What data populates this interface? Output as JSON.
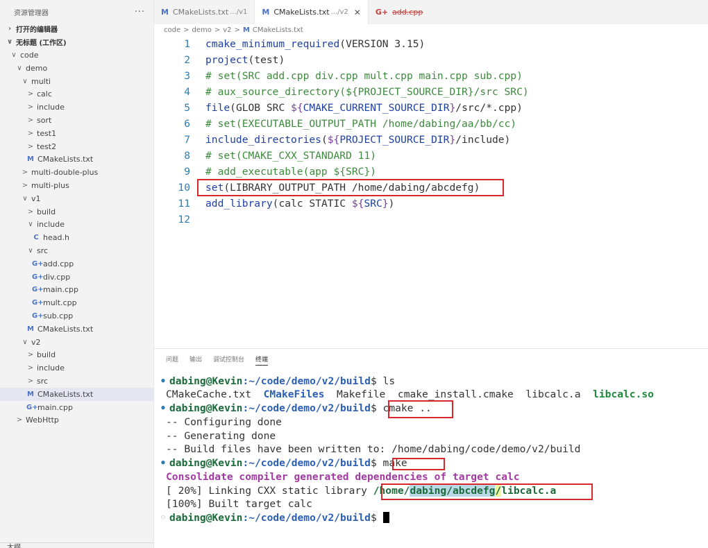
{
  "sidebar": {
    "title": "资源管理器",
    "more": "···",
    "open_editors": "打开的编辑器",
    "workspace": "无标题 (工作区)",
    "items": [
      {
        "label": "code",
        "chev": "∨",
        "indent": 1,
        "type": "folder"
      },
      {
        "label": "demo",
        "chev": "∨",
        "indent": 2,
        "type": "folder"
      },
      {
        "label": "multi",
        "chev": "∨",
        "indent": 3,
        "type": "folder"
      },
      {
        "label": "calc",
        "chev": ">",
        "indent": 4,
        "type": "folder"
      },
      {
        "label": "include",
        "chev": ">",
        "indent": 4,
        "type": "folder"
      },
      {
        "label": "sort",
        "chev": ">",
        "indent": 4,
        "type": "folder"
      },
      {
        "label": "test1",
        "chev": ">",
        "indent": 4,
        "type": "folder"
      },
      {
        "label": "test2",
        "chev": ">",
        "indent": 4,
        "type": "folder"
      },
      {
        "label": "CMakeLists.txt",
        "icon": "M",
        "indent": 4,
        "type": "cmake"
      },
      {
        "label": "multi-double-plus",
        "chev": ">",
        "indent": 3,
        "type": "folder"
      },
      {
        "label": "multi-plus",
        "chev": ">",
        "indent": 3,
        "type": "folder"
      },
      {
        "label": "v1",
        "chev": "∨",
        "indent": 3,
        "type": "folder"
      },
      {
        "label": "build",
        "chev": ">",
        "indent": 4,
        "type": "folder"
      },
      {
        "label": "include",
        "chev": "∨",
        "indent": 4,
        "type": "folder"
      },
      {
        "label": "head.h",
        "icon": "C",
        "indent": 5,
        "type": "header"
      },
      {
        "label": "src",
        "chev": "∨",
        "indent": 4,
        "type": "folder"
      },
      {
        "label": "add.cpp",
        "icon": "G+",
        "indent": 5,
        "type": "cpp"
      },
      {
        "label": "div.cpp",
        "icon": "G+",
        "indent": 5,
        "type": "cpp"
      },
      {
        "label": "main.cpp",
        "icon": "G+",
        "indent": 5,
        "type": "cpp"
      },
      {
        "label": "mult.cpp",
        "icon": "G+",
        "indent": 5,
        "type": "cpp"
      },
      {
        "label": "sub.cpp",
        "icon": "G+",
        "indent": 5,
        "type": "cpp"
      },
      {
        "label": "CMakeLists.txt",
        "icon": "M",
        "indent": 4,
        "type": "cmake"
      },
      {
        "label": "v2",
        "chev": "∨",
        "indent": 3,
        "type": "folder"
      },
      {
        "label": "build",
        "chev": ">",
        "indent": 4,
        "type": "folder"
      },
      {
        "label": "include",
        "chev": ">",
        "indent": 4,
        "type": "folder"
      },
      {
        "label": "src",
        "chev": ">",
        "indent": 4,
        "type": "folder"
      },
      {
        "label": "CMakeLists.txt",
        "icon": "M",
        "indent": 4,
        "type": "cmake",
        "selected": true
      },
      {
        "label": "main.cpp",
        "icon": "G+",
        "indent": 4,
        "type": "cpp"
      },
      {
        "label": "WebHttp",
        "chev": ">",
        "indent": 2,
        "type": "folder"
      }
    ],
    "outline": "大纲"
  },
  "tabs": [
    {
      "icon": "M",
      "name": "CMakeLists.txt",
      "hint": ".../v1",
      "active": false
    },
    {
      "icon": "M",
      "name": "CMakeLists.txt",
      "hint": ".../v2",
      "active": true,
      "close": "✕"
    },
    {
      "icon": "G+",
      "name": "add.cpp",
      "active": false,
      "deleted": true
    }
  ],
  "breadcrumb": {
    "parts": [
      "code",
      ">",
      "demo",
      ">",
      "v2",
      ">"
    ],
    "icon": "M",
    "file": "CMakeLists.txt"
  },
  "editor": {
    "lines": [
      {
        "n": "1",
        "segs": [
          [
            "fn",
            "cmake_minimum_required"
          ],
          [
            "",
            "(VERSION 3.15)"
          ]
        ]
      },
      {
        "n": "2",
        "segs": [
          [
            "fn",
            "project"
          ],
          [
            "",
            "(test)"
          ]
        ]
      },
      {
        "n": "3",
        "segs": [
          [
            "cm",
            "# set(SRC add.cpp div.cpp mult.cpp main.cpp sub.cpp)"
          ]
        ]
      },
      {
        "n": "4",
        "segs": [
          [
            "cm",
            "# aux_source_directory(${PROJECT_SOURCE_DIR}/src SRC)"
          ]
        ]
      },
      {
        "n": "5",
        "segs": [
          [
            "fn",
            "file"
          ],
          [
            "",
            "(GLOB SRC "
          ],
          [
            "k",
            "${"
          ],
          [
            "var",
            "CMAKE_CURRENT_SOURCE_DIR"
          ],
          [
            "k",
            "}"
          ],
          [
            "",
            "/src/*.cpp)"
          ]
        ]
      },
      {
        "n": "6",
        "segs": [
          [
            "cm",
            "# set(EXECUTABLE_OUTPUT_PATH /home/dabing/aa/bb/cc)"
          ]
        ]
      },
      {
        "n": "7",
        "segs": [
          [
            "fn",
            "include_directories"
          ],
          [
            "",
            "("
          ],
          [
            "k",
            "${"
          ],
          [
            "var",
            "PROJECT_SOURCE_DIR"
          ],
          [
            "k",
            "}"
          ],
          [
            "",
            "/include)"
          ]
        ]
      },
      {
        "n": "8",
        "segs": [
          [
            "cm",
            "# set(CMAKE_CXX_STANDARD 11)"
          ]
        ]
      },
      {
        "n": "9",
        "segs": [
          [
            "cm",
            "# add_executable(app ${SRC})"
          ]
        ]
      },
      {
        "n": "10",
        "segs": [
          [
            "fn",
            "set"
          ],
          [
            "",
            "(LIBRARY_OUTPUT_PATH /home/dabing/abcdefg)"
          ]
        ]
      },
      {
        "n": "11",
        "segs": [
          [
            "fn",
            "add_library"
          ],
          [
            "",
            "(calc STATIC "
          ],
          [
            "k",
            "${"
          ],
          [
            "var",
            "SRC"
          ],
          [
            "k",
            "}"
          ],
          [
            "",
            ")"
          ]
        ]
      },
      {
        "n": "12",
        "segs": []
      }
    ]
  },
  "panel": {
    "tabs": [
      "问题",
      "输出",
      "调试控制台",
      "终端"
    ],
    "active_tab": 3
  },
  "terminal": {
    "prompt": "dabing@Kevin",
    "path": ":~/code/demo/v2/build",
    "dollar": "$",
    "cmd_ls": " ls",
    "ls_out": [
      "CMakeCache.txt  ",
      "CMakeFiles",
      "  Makefile  cmake_install.cmake  libcalc.a  ",
      "libcalc.so"
    ],
    "cmd_cmake": " cmake ..",
    "cmake_out": [
      "-- Configuring done",
      "-- Generating done",
      "-- Build files have been written to: /home/dabing/code/demo/v2/build"
    ],
    "cmd_make": " make",
    "make_msg": "Consolidate compiler generated dependencies of target calc",
    "link_prefix": "[ 20%] Linking CXX static library ",
    "link_path_a": "/home/",
    "link_path_b": "dabing/abcdefg",
    "link_path_c": "/",
    "link_path_d": "libcalc.a",
    "built": "[100%] Built target calc"
  }
}
